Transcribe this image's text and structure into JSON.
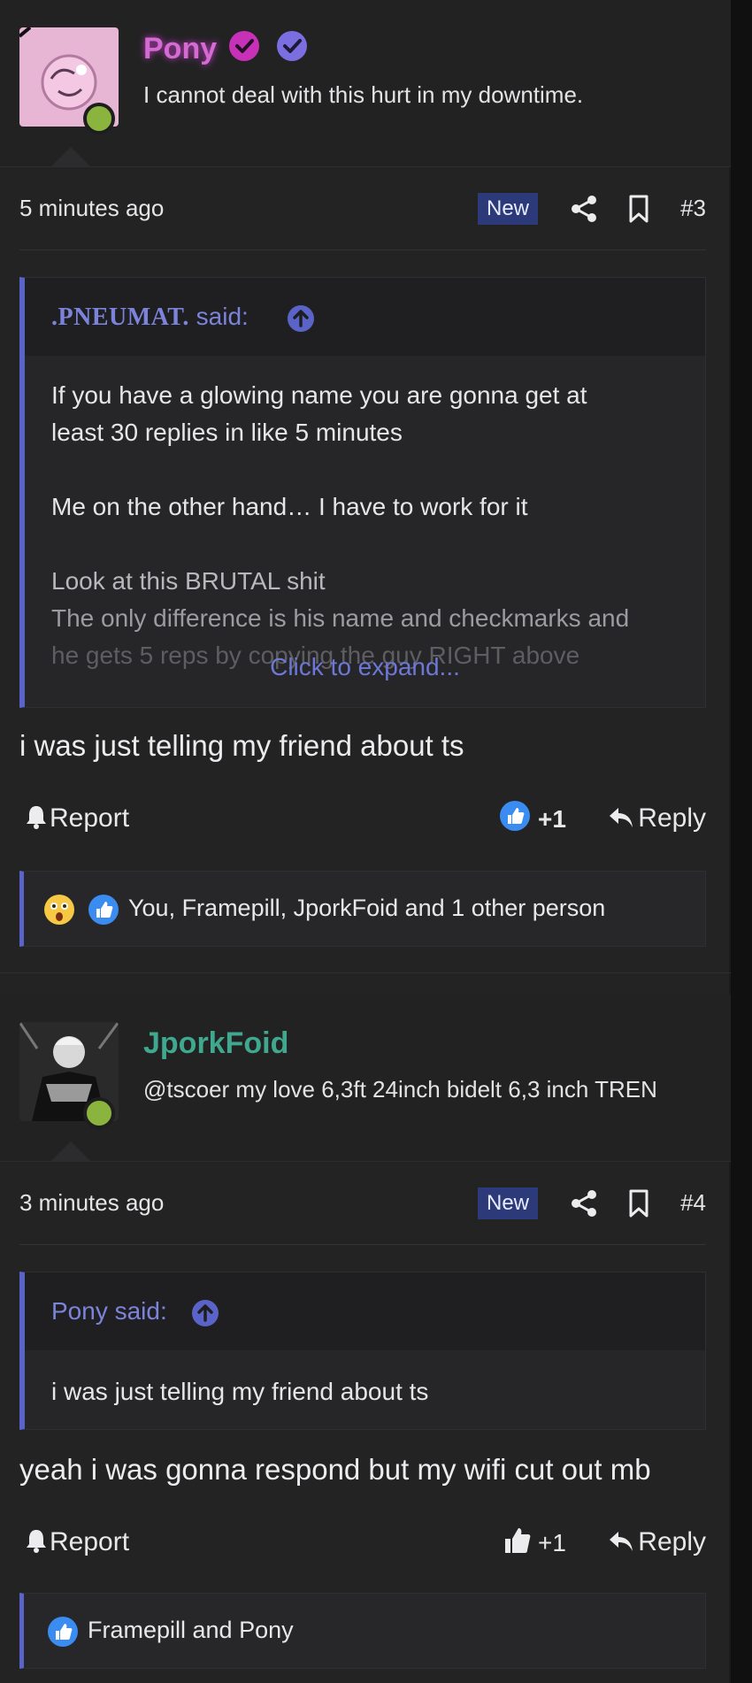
{
  "posts": [
    {
      "username": "Pony",
      "username_color": "#d36bd2",
      "status": "I cannot deal with this hurt in my downtime.",
      "time": "5 minutes ago",
      "badge": "New",
      "post_number": "#3",
      "quote": {
        "author": ".PNEUMAT.",
        "said": " said:",
        "lines": [
          "If you have a glowing name you are gonna get at",
          "least 30 replies in like 5 minutes",
          "Me on the other hand… I have to work for it",
          "Look at this BRUTAL shit",
          "The only difference is his name and checkmarks and",
          "he gets 5 reps by copying the guy RIGHT above"
        ],
        "expand": "Click to expand..."
      },
      "message": "i was just telling my friend about ts",
      "report": "Report",
      "like_count": "+1",
      "reply": "Reply",
      "reactions": "You, Framepill, JporkFoid and 1 other person"
    },
    {
      "username": "JporkFoid",
      "username_color": "#3fa88e",
      "status": "@tscoer my love 6,3ft 24inch bidelt 6,3 inch TREN",
      "time": "3 minutes ago",
      "badge": "New",
      "post_number": "#4",
      "quote": {
        "author": "Pony",
        "said": " said:",
        "lines": [
          "i was just telling my friend about ts"
        ]
      },
      "message": "yeah i was gonna respond but my wifi cut out mb",
      "report": "Report",
      "like_count": "+1",
      "reply": "Reply",
      "reactions": "Framepill and Pony"
    }
  ],
  "icons": {
    "verified_pink": "check-badge-pink",
    "verified_purple": "check-badge-purple",
    "share": "share-icon",
    "bookmark": "bookmark-icon",
    "bell": "bell-icon",
    "like": "thumbs-up-icon",
    "reply": "reply-arrow-icon",
    "wow": "surprised-face-icon"
  },
  "colors": {
    "accent": "#5a64c8",
    "background": "#232324",
    "online": "#8bb43f",
    "badge_bg": "#2c3a7a"
  }
}
